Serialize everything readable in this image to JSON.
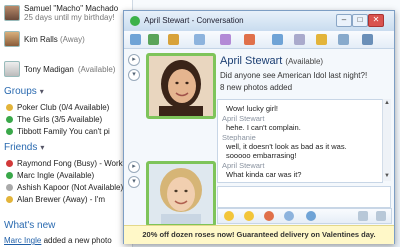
{
  "contacts": [
    {
      "name": "Samuel \"Macho\" Machado",
      "status": "25 days until my birthday!"
    },
    {
      "name": "Kim Ralls",
      "status": "(Away)"
    },
    {
      "name": "Tony Madigan",
      "status": "(Available)"
    }
  ],
  "groups": {
    "title": "Groups",
    "items": [
      {
        "label": "Poker Club (0/4 Available)",
        "color": "#e3b43a"
      },
      {
        "label": "The Girls (3/5 Available)",
        "color": "#3aa84a"
      },
      {
        "label": "Tibbott Family You can't pi",
        "color": "#3aa84a"
      }
    ]
  },
  "friends": {
    "title": "Friends",
    "items": [
      {
        "label": "Raymond Fong (Busy) - Work",
        "color": "#d23a3a"
      },
      {
        "label": "Marc Ingle (Available)",
        "color": "#3aa84a"
      },
      {
        "label": "Ashish Kapoor (Not Available)",
        "color": "#aaaaaa"
      },
      {
        "label": "Alan Brewer (Away) - I'm",
        "color": "#e3b43a"
      }
    ]
  },
  "whats_new": {
    "title": "What's new",
    "link": "Marc Ingle",
    "text": " added a new photo"
  },
  "conversation": {
    "window_title": "April Stewart - Conversation",
    "contact_name": "April Stewart",
    "contact_status": "(Available)",
    "personal_message": "Did anyone see American Idol last night?!",
    "new_photos": "8 new photos added",
    "messages": [
      {
        "sender": "",
        "text": "Wow! lucky girl!"
      },
      {
        "sender": "April Stewart",
        "text": ""
      },
      {
        "sender": "",
        "text": "hehe. I can't complain."
      },
      {
        "sender": "Stephanie",
        "text": ""
      },
      {
        "sender": "",
        "text": "well, it doesn't look as bad as it was."
      },
      {
        "sender": "",
        "text": "sooooo embarrasing!"
      },
      {
        "sender": "April Stewart",
        "text": ""
      },
      {
        "sender": "",
        "text": "What kinda car was it?"
      }
    ],
    "banner": "20% off dozen roses now! Guaranteed delivery on Valentines day.",
    "colors": {
      "frame": "#7ec45a",
      "title": "#1c3f73"
    }
  }
}
